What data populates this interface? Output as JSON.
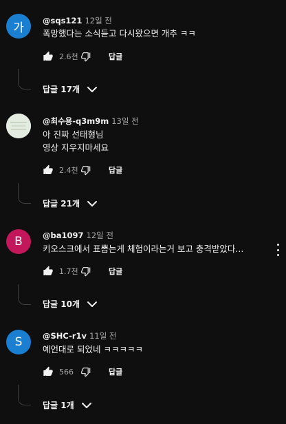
{
  "comments": [
    {
      "avatar_letter": "가",
      "avatar_color": "#1a7fd1",
      "author": "@sqs121",
      "time": "12일 전",
      "lines": [
        "폭망했다는 소식듣고 다시왔으면  개추 ㅋㅋ"
      ],
      "likes": "2.6천",
      "reply_label": "답글",
      "replies": "답글 17개"
    },
    {
      "avatar_letter": "",
      "avatar_color": "#dfe6d9",
      "author": "@최수용-q3m9m",
      "time": "13일 전",
      "lines": [
        "아 진짜 선태형님",
        "영상 지우지마세요"
      ],
      "likes": "2.4천",
      "reply_label": "답글",
      "replies": "답글 21개"
    },
    {
      "avatar_letter": "B",
      "avatar_color": "#c2185b",
      "author": "@ba1097",
      "time": "12일 전",
      "lines": [
        "키오스크에서 표뽑는게 체험이라는거 보고 충격받았다..."
      ],
      "likes": "1.7천",
      "reply_label": "답글",
      "replies": "답글 10개"
    },
    {
      "avatar_letter": "S",
      "avatar_color": "#1a7fd1",
      "author": "@SHC-r1v",
      "time": "11일 전",
      "lines": [
        "예언대로 되었네 ㅋㅋㅋㅋㅋ"
      ],
      "likes": "566",
      "reply_label": "답글",
      "replies": "답글 1개"
    }
  ],
  "icons": {
    "like": "thumb-up-icon",
    "dislike": "thumb-down-icon",
    "expand": "chevron-down-icon",
    "more": "more-vert-icon"
  }
}
